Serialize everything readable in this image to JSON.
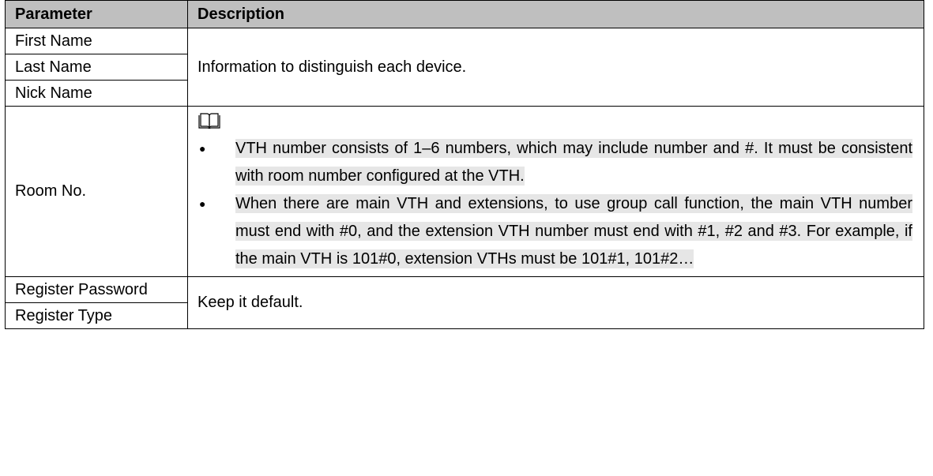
{
  "headers": {
    "parameter": "Parameter",
    "description": "Description"
  },
  "rows": {
    "first_name": "First Name",
    "last_name": "Last Name",
    "nick_name": "Nick Name",
    "names_desc": "Information to distinguish each device.",
    "room_no": "Room No.",
    "room_notes": [
      "VTH number consists of 1–6 numbers, which may include number and #. It must be consistent with room number configured at the VTH.",
      "When there are main VTH and extensions, to use group call function, the main VTH number must end with #0, and the extension VTH number must end with #1, #2 and #3. For example, if the main VTH is 101#0, extension VTHs must be 101#1, 101#2…"
    ],
    "register_password": "Register Password",
    "register_type": "Register Type",
    "register_desc": "Keep it default."
  },
  "icons": {
    "note": "book-note-icon"
  }
}
